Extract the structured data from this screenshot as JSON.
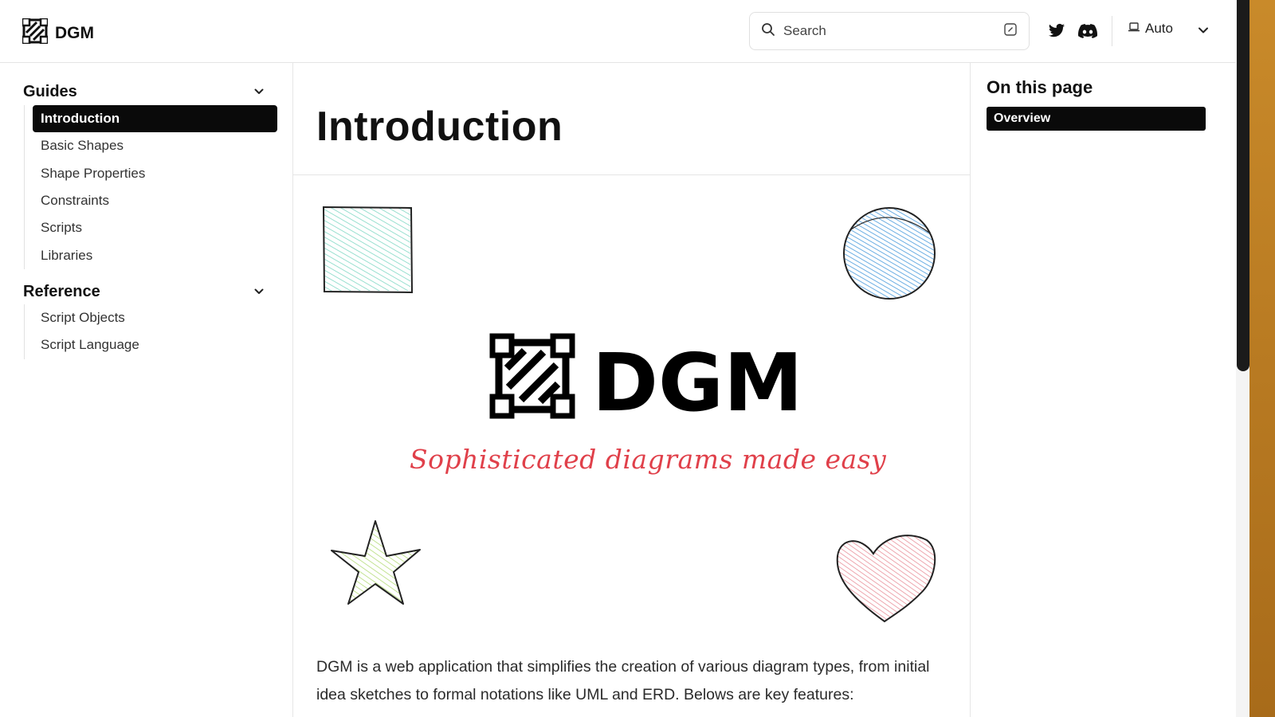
{
  "header": {
    "logo_text": "DGM",
    "search_placeholder": "Search",
    "theme_label": "Auto"
  },
  "icons": {
    "logo": "dgm-logo-icon",
    "search": "search-icon",
    "shortcut": "keyboard-shortcut-icon",
    "twitter": "twitter-icon",
    "discord": "discord-icon",
    "theme": "laptop-icon",
    "chevron": "chevron-down-icon"
  },
  "sidebar": {
    "groups": [
      {
        "title": "Guides",
        "items": [
          {
            "label": "Introduction",
            "active": true
          },
          {
            "label": "Basic Shapes"
          },
          {
            "label": "Shape Properties"
          },
          {
            "label": "Constraints"
          },
          {
            "label": "Scripts"
          },
          {
            "label": "Libraries"
          }
        ]
      },
      {
        "title": "Reference",
        "items": [
          {
            "label": "Script Objects"
          },
          {
            "label": "Script Language"
          }
        ]
      }
    ]
  },
  "main": {
    "title": "Introduction",
    "hero_logo_text": "DGM",
    "tagline": "Sophisticated diagrams made easy",
    "intro": "DGM is a web application that simplifies the creation of various diagram types, from initial idea sketches to formal notations like UML and ERD. Belows are key features:"
  },
  "toc": {
    "title": "On this page",
    "items": [
      {
        "label": "Overview",
        "active": true
      }
    ]
  },
  "colors": {
    "accent": "#0a0a0a",
    "tagline": "#e0404a",
    "square_fill": "#9fe3d4",
    "circle_fill": "#7fb8e8",
    "star_fill": "#c9e89a",
    "heart_fill": "#f0a0a8"
  }
}
